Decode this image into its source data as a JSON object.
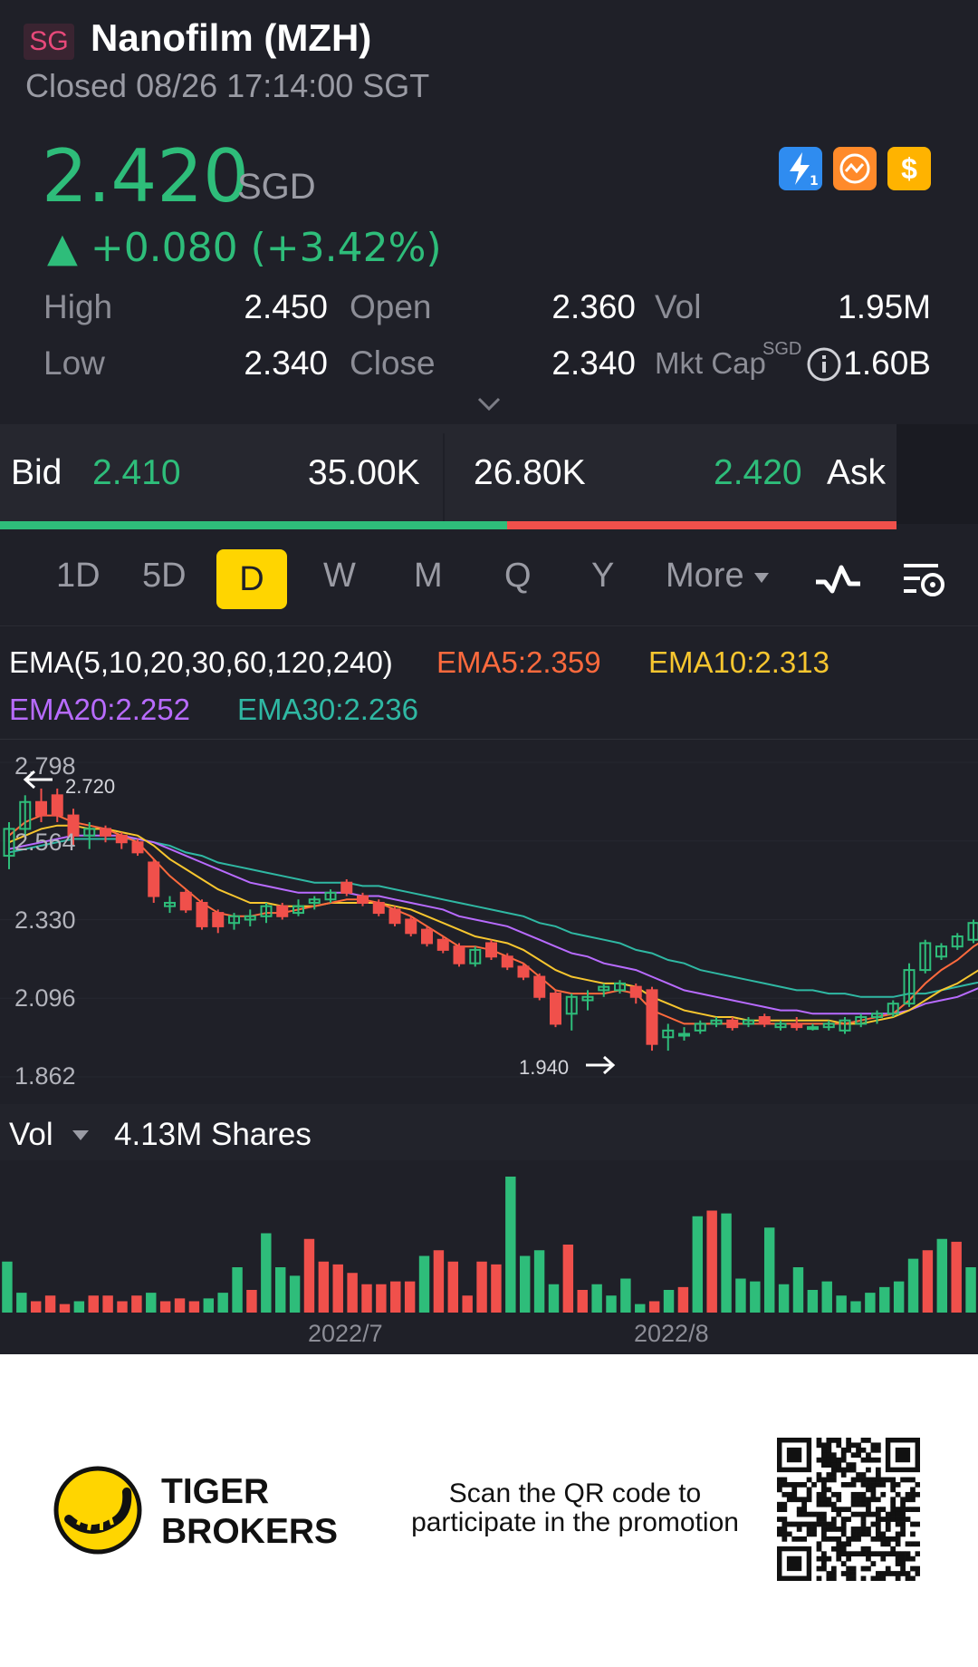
{
  "header": {
    "market_badge": "SG",
    "title": "Nanofilm (MZH)",
    "status": "Closed 08/26 17:14:00 SGT"
  },
  "quote": {
    "price": "2.420",
    "currency": "SGD",
    "change": "▲ +0.080 (+3.42%)",
    "quick_icons": [
      "lightning-icon",
      "swap-icon",
      "dollar-icon"
    ]
  },
  "stats": {
    "high_label": "High",
    "high": "2.450",
    "low_label": "Low",
    "low": "2.340",
    "open_label": "Open",
    "open": "2.360",
    "close_label": "Close",
    "close": "2.340",
    "vol_label": "Vol",
    "vol": "1.95M",
    "mktcap_label": "Mkt Cap",
    "mktcap_currency": "SGD",
    "mktcap": "1.60B"
  },
  "bidask": {
    "bid_label": "Bid",
    "bid_price": "2.410",
    "bid_size": "35.00K",
    "ask_size": "26.80K",
    "ask_price": "2.420",
    "ask_label": "Ask",
    "bid_share": 0.566
  },
  "period_tabs": [
    "1D",
    "5D",
    "D",
    "W",
    "M",
    "Q",
    "Y",
    "More"
  ],
  "active_tab": "D",
  "ema": {
    "title": "EMA(5,10,20,30,60,120,240)",
    "ema5": "EMA5:2.359",
    "ema10": "EMA10:2.313",
    "ema20": "EMA20:2.252",
    "ema30": "EMA30:2.236"
  },
  "chart": {
    "y_ticks": [
      "2.798",
      "2.564",
      "2.330",
      "2.096",
      "1.862"
    ],
    "high_marker": "2.720",
    "low_marker": "1.940"
  },
  "volume": {
    "label": "Vol",
    "value": "4.13M Shares",
    "dates": [
      "2022/7",
      "2022/8"
    ]
  },
  "footer": {
    "brand_line1": "TIGER",
    "brand_line2": "BROKERS",
    "promo_line1": "Scan the QR code to",
    "promo_line2": "participate in the promotion"
  },
  "colors": {
    "up": "#2ebd7a",
    "down": "#f0504b",
    "ema5": "#ff6a3d",
    "ema10": "#f7c62f",
    "ema20": "#b86bff",
    "ema30": "#2fb8a3",
    "highlight": "#ffd500"
  },
  "chart_data": {
    "type": "candlestick",
    "ylim": [
      1.862,
      2.798
    ],
    "candles": [
      {
        "o": 2.52,
        "h": 2.62,
        "l": 2.48,
        "c": 2.6
      },
      {
        "o": 2.6,
        "h": 2.7,
        "l": 2.58,
        "c": 2.68
      },
      {
        "o": 2.68,
        "h": 2.72,
        "l": 2.62,
        "c": 2.64
      },
      {
        "o": 2.7,
        "h": 2.72,
        "l": 2.62,
        "c": 2.64
      },
      {
        "o": 2.64,
        "h": 2.66,
        "l": 2.55,
        "c": 2.58
      },
      {
        "o": 2.58,
        "h": 2.62,
        "l": 2.54,
        "c": 2.6
      },
      {
        "o": 2.6,
        "h": 2.61,
        "l": 2.56,
        "c": 2.58
      },
      {
        "o": 2.58,
        "h": 2.59,
        "l": 2.54,
        "c": 2.56
      },
      {
        "o": 2.56,
        "h": 2.57,
        "l": 2.52,
        "c": 2.53
      },
      {
        "o": 2.5,
        "h": 2.51,
        "l": 2.38,
        "c": 2.4
      },
      {
        "o": 2.37,
        "h": 2.4,
        "l": 2.35,
        "c": 2.38
      },
      {
        "o": 2.41,
        "h": 2.42,
        "l": 2.35,
        "c": 2.36
      },
      {
        "o": 2.38,
        "h": 2.39,
        "l": 2.3,
        "c": 2.31
      },
      {
        "o": 2.35,
        "h": 2.36,
        "l": 2.29,
        "c": 2.31
      },
      {
        "o": 2.32,
        "h": 2.35,
        "l": 2.3,
        "c": 2.34
      },
      {
        "o": 2.33,
        "h": 2.36,
        "l": 2.31,
        "c": 2.34
      },
      {
        "o": 2.34,
        "h": 2.38,
        "l": 2.32,
        "c": 2.37
      },
      {
        "o": 2.37,
        "h": 2.38,
        "l": 2.33,
        "c": 2.34
      },
      {
        "o": 2.35,
        "h": 2.39,
        "l": 2.34,
        "c": 2.37
      },
      {
        "o": 2.38,
        "h": 2.4,
        "l": 2.36,
        "c": 2.39
      },
      {
        "o": 2.39,
        "h": 2.42,
        "l": 2.38,
        "c": 2.41
      },
      {
        "o": 2.44,
        "h": 2.45,
        "l": 2.4,
        "c": 2.41
      },
      {
        "o": 2.4,
        "h": 2.41,
        "l": 2.37,
        "c": 2.38
      },
      {
        "o": 2.38,
        "h": 2.39,
        "l": 2.34,
        "c": 2.35
      },
      {
        "o": 2.36,
        "h": 2.37,
        "l": 2.31,
        "c": 2.32
      },
      {
        "o": 2.33,
        "h": 2.34,
        "l": 2.28,
        "c": 2.29
      },
      {
        "o": 2.3,
        "h": 2.31,
        "l": 2.25,
        "c": 2.26
      },
      {
        "o": 2.27,
        "h": 2.28,
        "l": 2.23,
        "c": 2.24
      },
      {
        "o": 2.25,
        "h": 2.26,
        "l": 2.19,
        "c": 2.2
      },
      {
        "o": 2.2,
        "h": 2.25,
        "l": 2.19,
        "c": 2.24
      },
      {
        "o": 2.26,
        "h": 2.27,
        "l": 2.21,
        "c": 2.22
      },
      {
        "o": 2.22,
        "h": 2.23,
        "l": 2.18,
        "c": 2.19
      },
      {
        "o": 2.19,
        "h": 2.2,
        "l": 2.15,
        "c": 2.16
      },
      {
        "o": 2.16,
        "h": 2.17,
        "l": 2.09,
        "c": 2.1
      },
      {
        "o": 2.11,
        "h": 2.12,
        "l": 2.01,
        "c": 2.02
      },
      {
        "o": 2.05,
        "h": 2.11,
        "l": 2.0,
        "c": 2.1
      },
      {
        "o": 2.09,
        "h": 2.12,
        "l": 2.06,
        "c": 2.1
      },
      {
        "o": 2.12,
        "h": 2.14,
        "l": 2.1,
        "c": 2.13
      },
      {
        "o": 2.12,
        "h": 2.15,
        "l": 2.11,
        "c": 2.14
      },
      {
        "o": 2.13,
        "h": 2.14,
        "l": 2.08,
        "c": 2.1
      },
      {
        "o": 2.12,
        "h": 2.13,
        "l": 1.94,
        "c": 1.96
      },
      {
        "o": 1.98,
        "h": 2.02,
        "l": 1.94,
        "c": 2.0
      },
      {
        "o": 1.99,
        "h": 2.01,
        "l": 1.97,
        "c": 1.99
      },
      {
        "o": 2.0,
        "h": 2.03,
        "l": 1.99,
        "c": 2.02
      },
      {
        "o": 2.02,
        "h": 2.04,
        "l": 2.01,
        "c": 2.03
      },
      {
        "o": 2.03,
        "h": 2.04,
        "l": 2.0,
        "c": 2.01
      },
      {
        "o": 2.02,
        "h": 2.04,
        "l": 2.01,
        "c": 2.03
      },
      {
        "o": 2.04,
        "h": 2.05,
        "l": 2.01,
        "c": 2.02
      },
      {
        "o": 2.01,
        "h": 2.03,
        "l": 2.0,
        "c": 2.02
      },
      {
        "o": 2.02,
        "h": 2.04,
        "l": 2.0,
        "c": 2.01
      },
      {
        "o": 2.01,
        "h": 2.02,
        "l": 2.0,
        "c": 2.01
      },
      {
        "o": 2.01,
        "h": 2.03,
        "l": 2.0,
        "c": 2.02
      },
      {
        "o": 2.0,
        "h": 2.04,
        "l": 1.99,
        "c": 2.03
      },
      {
        "o": 2.02,
        "h": 2.05,
        "l": 2.01,
        "c": 2.04
      },
      {
        "o": 2.04,
        "h": 2.06,
        "l": 2.02,
        "c": 2.05
      },
      {
        "o": 2.05,
        "h": 2.09,
        "l": 2.04,
        "c": 2.08
      },
      {
        "o": 2.08,
        "h": 2.2,
        "l": 2.07,
        "c": 2.18
      },
      {
        "o": 2.18,
        "h": 2.27,
        "l": 2.17,
        "c": 2.26
      },
      {
        "o": 2.22,
        "h": 2.26,
        "l": 2.21,
        "c": 2.25
      },
      {
        "o": 2.25,
        "h": 2.29,
        "l": 2.24,
        "c": 2.28
      },
      {
        "o": 2.27,
        "h": 2.33,
        "l": 2.26,
        "c": 2.32
      },
      {
        "o": 2.32,
        "h": 2.35,
        "l": 2.31,
        "c": 2.34
      },
      {
        "o": 2.34,
        "h": 2.37,
        "l": 2.33,
        "c": 2.36
      },
      {
        "o": 2.36,
        "h": 2.4,
        "l": 2.35,
        "c": 2.38
      },
      {
        "o": 2.38,
        "h": 2.39,
        "l": 2.28,
        "c": 2.3
      },
      {
        "o": 2.3,
        "h": 2.39,
        "l": 2.29,
        "c": 2.38
      },
      {
        "o": 2.36,
        "h": 2.38,
        "l": 2.33,
        "c": 2.35
      },
      {
        "o": 2.35,
        "h": 2.37,
        "l": 2.34,
        "c": 2.36
      },
      {
        "o": 2.36,
        "h": 2.45,
        "l": 2.34,
        "c": 2.42
      }
    ],
    "ema5": [
      2.58,
      2.62,
      2.64,
      2.64,
      2.62,
      2.61,
      2.6,
      2.58,
      2.56,
      2.51,
      2.46,
      2.42,
      2.38,
      2.35,
      2.34,
      2.34,
      2.35,
      2.35,
      2.36,
      2.37,
      2.38,
      2.39,
      2.39,
      2.38,
      2.36,
      2.34,
      2.31,
      2.28,
      2.25,
      2.25,
      2.24,
      2.22,
      2.2,
      2.16,
      2.12,
      2.11,
      2.11,
      2.11,
      2.12,
      2.11,
      2.06,
      2.04,
      2.02,
      2.02,
      2.02,
      2.02,
      2.02,
      2.02,
      2.02,
      2.02,
      2.02,
      2.02,
      2.02,
      2.03,
      2.04,
      2.05,
      2.09,
      2.14,
      2.18,
      2.21,
      2.25,
      2.28,
      2.31,
      2.34,
      2.33,
      2.34,
      2.35,
      2.35,
      2.359
    ],
    "ema10": [
      2.56,
      2.58,
      2.6,
      2.61,
      2.61,
      2.6,
      2.6,
      2.59,
      2.58,
      2.55,
      2.51,
      2.48,
      2.45,
      2.42,
      2.4,
      2.38,
      2.38,
      2.37,
      2.37,
      2.37,
      2.38,
      2.38,
      2.38,
      2.38,
      2.37,
      2.36,
      2.34,
      2.32,
      2.3,
      2.28,
      2.27,
      2.26,
      2.24,
      2.21,
      2.18,
      2.16,
      2.15,
      2.14,
      2.14,
      2.13,
      2.1,
      2.08,
      2.06,
      2.05,
      2.04,
      2.04,
      2.03,
      2.03,
      2.03,
      2.03,
      2.03,
      2.03,
      2.02,
      2.02,
      2.03,
      2.04,
      2.06,
      2.09,
      2.12,
      2.14,
      2.17,
      2.2,
      2.23,
      2.25,
      2.26,
      2.28,
      2.29,
      2.3,
      2.313
    ],
    "ema20": [
      2.54,
      2.55,
      2.56,
      2.57,
      2.58,
      2.58,
      2.58,
      2.58,
      2.57,
      2.56,
      2.54,
      2.52,
      2.5,
      2.48,
      2.46,
      2.44,
      2.43,
      2.42,
      2.41,
      2.41,
      2.41,
      2.41,
      2.4,
      2.4,
      2.39,
      2.38,
      2.37,
      2.36,
      2.34,
      2.33,
      2.32,
      2.31,
      2.29,
      2.27,
      2.25,
      2.23,
      2.22,
      2.2,
      2.19,
      2.18,
      2.16,
      2.14,
      2.12,
      2.11,
      2.1,
      2.09,
      2.08,
      2.07,
      2.06,
      2.06,
      2.05,
      2.05,
      2.05,
      2.05,
      2.05,
      2.05,
      2.06,
      2.08,
      2.09,
      2.1,
      2.12,
      2.14,
      2.16,
      2.18,
      2.19,
      2.21,
      2.22,
      2.23,
      2.252
    ],
    "ema30": [
      2.53,
      2.54,
      2.55,
      2.56,
      2.57,
      2.57,
      2.57,
      2.57,
      2.57,
      2.56,
      2.55,
      2.53,
      2.52,
      2.5,
      2.49,
      2.48,
      2.47,
      2.46,
      2.45,
      2.44,
      2.44,
      2.44,
      2.43,
      2.43,
      2.42,
      2.41,
      2.4,
      2.39,
      2.38,
      2.37,
      2.36,
      2.35,
      2.34,
      2.32,
      2.31,
      2.29,
      2.28,
      2.27,
      2.26,
      2.24,
      2.23,
      2.21,
      2.2,
      2.18,
      2.17,
      2.16,
      2.15,
      2.14,
      2.13,
      2.12,
      2.12,
      2.11,
      2.11,
      2.1,
      2.1,
      2.1,
      2.11,
      2.11,
      2.12,
      2.13,
      2.14,
      2.15,
      2.17,
      2.18,
      2.19,
      2.2,
      2.21,
      2.22,
      2.236
    ],
    "volume": [
      0.9,
      0.35,
      0.2,
      0.3,
      0.15,
      0.2,
      0.3,
      0.3,
      0.2,
      0.3,
      0.35,
      0.2,
      0.25,
      0.2,
      0.25,
      0.35,
      0.8,
      0.4,
      1.4,
      0.8,
      0.65,
      1.3,
      0.9,
      0.85,
      0.7,
      0.5,
      0.5,
      0.55,
      0.55,
      1.0,
      1.1,
      0.9,
      0.3,
      0.9,
      0.85,
      2.4,
      1.0,
      1.1,
      0.5,
      1.2,
      0.4,
      0.5,
      0.3,
      0.6,
      0.15,
      0.2,
      0.4,
      0.45,
      1.7,
      1.8,
      1.75,
      0.6,
      0.55,
      1.5,
      0.5,
      0.8,
      0.4,
      0.55,
      0.3,
      0.2,
      0.35,
      0.45,
      0.55,
      0.95,
      1.1,
      1.3,
      1.25,
      0.8
    ]
  }
}
